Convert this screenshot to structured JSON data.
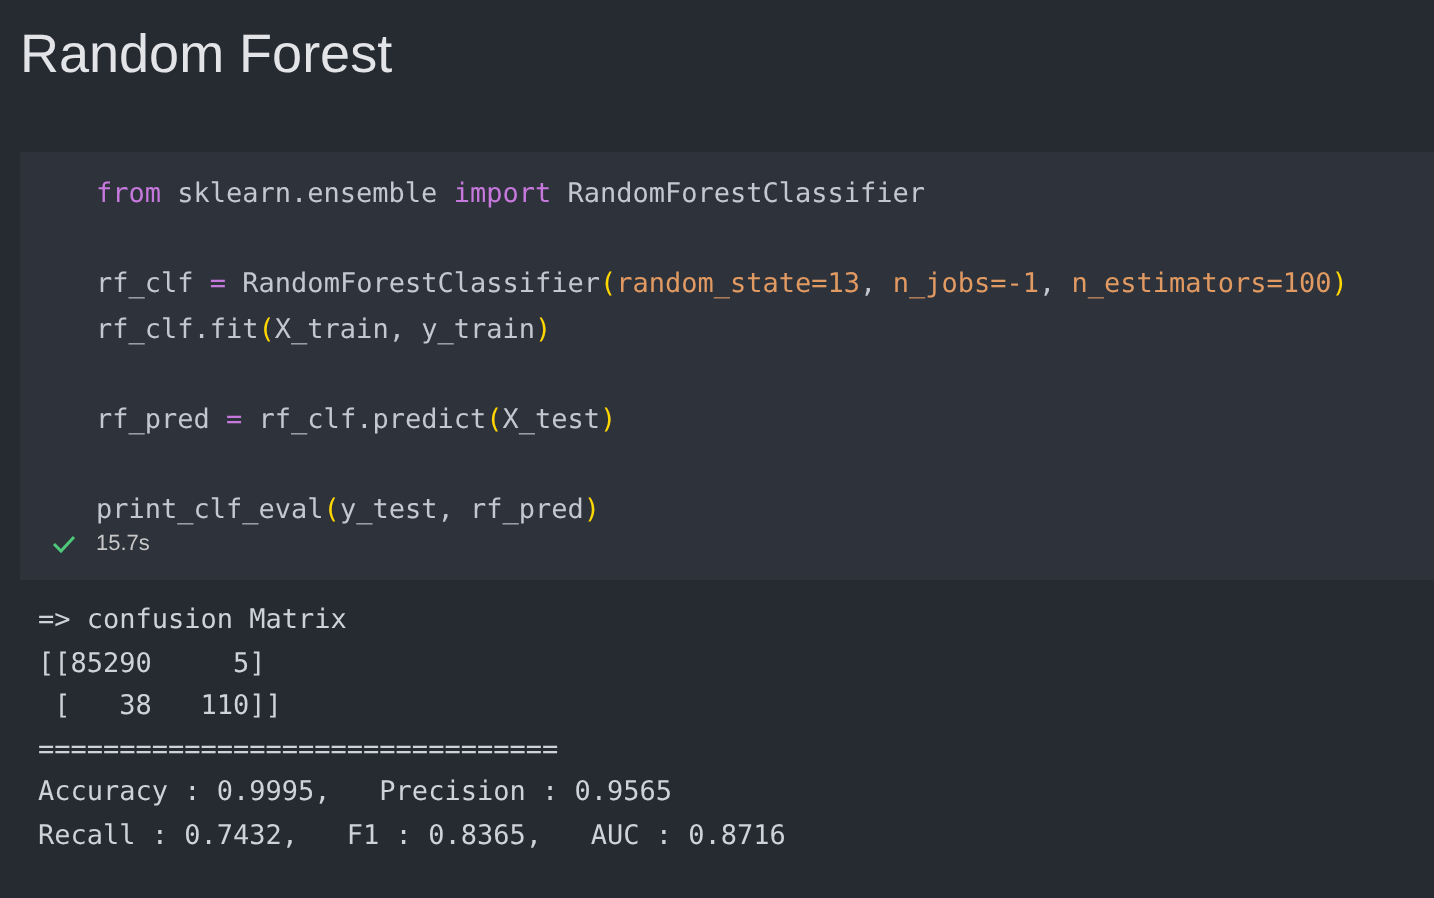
{
  "heading": "Random Forest",
  "cell": {
    "lines": [
      {
        "kind": "code",
        "tokens": [
          {
            "kind": "keyword",
            "text": "from"
          },
          {
            "kind": "plain",
            "text": " sklearn.ensemble "
          },
          {
            "kind": "keyword",
            "text": "import"
          },
          {
            "kind": "plain",
            "text": " RandomForestClassifier"
          }
        ]
      },
      {
        "kind": "blank"
      },
      {
        "kind": "code",
        "tokens": [
          {
            "kind": "plain",
            "text": "rf_clf "
          },
          {
            "kind": "operator",
            "text": "="
          },
          {
            "kind": "plain",
            "text": " RandomForestClassifier"
          },
          {
            "kind": "paren",
            "text": "("
          },
          {
            "kind": "param",
            "text": "random_state=13"
          },
          {
            "kind": "plain",
            "text": ", "
          },
          {
            "kind": "param",
            "text": "n_jobs=-1"
          },
          {
            "kind": "plain",
            "text": ", "
          },
          {
            "kind": "param",
            "text": "n_estimators=100"
          },
          {
            "kind": "paren",
            "text": ")"
          }
        ]
      },
      {
        "kind": "code",
        "tokens": [
          {
            "kind": "plain",
            "text": "rf_clf.fit"
          },
          {
            "kind": "paren",
            "text": "("
          },
          {
            "kind": "plain",
            "text": "X_train, y_train"
          },
          {
            "kind": "paren",
            "text": ")"
          }
        ]
      },
      {
        "kind": "blank"
      },
      {
        "kind": "code",
        "tokens": [
          {
            "kind": "plain",
            "text": "rf_pred "
          },
          {
            "kind": "operator",
            "text": "="
          },
          {
            "kind": "plain",
            "text": " rf_clf.predict"
          },
          {
            "kind": "paren",
            "text": "("
          },
          {
            "kind": "plain",
            "text": "X_test"
          },
          {
            "kind": "paren",
            "text": ")"
          }
        ]
      },
      {
        "kind": "blank"
      },
      {
        "kind": "code",
        "tokens": [
          {
            "kind": "plain",
            "text": "print_clf_eval"
          },
          {
            "kind": "paren",
            "text": "("
          },
          {
            "kind": "plain",
            "text": "y_test, rf_pred"
          },
          {
            "kind": "paren",
            "text": ")"
          }
        ]
      }
    ],
    "status": {
      "succeeded": true,
      "time": "15.7s"
    }
  },
  "output": [
    "=> confusion Matrix",
    "[[85290     5]",
    " [   38   110]]",
    "================================",
    "Accuracy : 0.9995,   Precision : 0.9565",
    "Recall : 0.7432,   F1 : 0.8365,   AUC : 0.8716"
  ]
}
